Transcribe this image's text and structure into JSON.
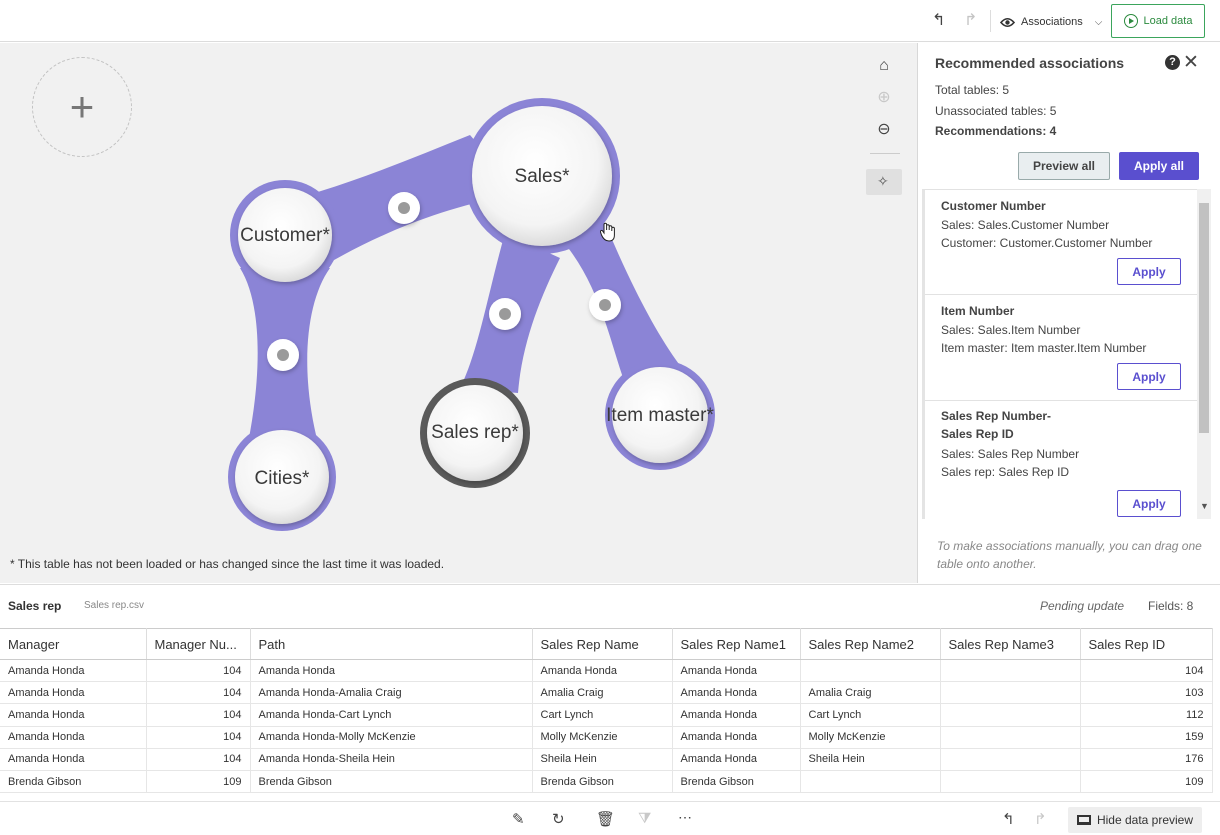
{
  "toolbar": {
    "undo_icon": "undo-icon",
    "redo_icon": "redo-icon",
    "associations_label": "Associations",
    "load_data_label": "Load data",
    "accent_color": "#2b8a3e"
  },
  "canvas": {
    "add_label": "+",
    "nodes": [
      {
        "label": "Customer*"
      },
      {
        "label": "Sales*"
      },
      {
        "label": "Cities*"
      },
      {
        "label": "Sales rep*"
      },
      {
        "label": "Item master*"
      }
    ],
    "footnote": "* This table has not been loaded or has changed since the last time it was loaded.",
    "link_color": "#8b84d6"
  },
  "panel": {
    "title": "Recommended associations",
    "total_tables": "Total tables: 5",
    "unassociated_tables": "Unassociated tables: 5",
    "recommendations": "Recommendations: 4",
    "preview_all": "Preview all",
    "apply_all": "Apply all",
    "apply_color": "#5a4fcf",
    "cards": [
      {
        "title": "Customer Number",
        "line1": "Sales: Sales.Customer Number",
        "line2": "Customer: Customer.Customer Number",
        "apply": "Apply"
      },
      {
        "title": "Item Number",
        "line1": "Sales: Sales.Item Number",
        "line2": "Item master: Item master.Item Number",
        "apply": "Apply"
      },
      {
        "title": "Sales Rep Number-Sales Rep ID",
        "line1": "Sales: Sales Rep Number",
        "line2": "Sales rep: Sales Rep ID",
        "apply": "Apply"
      }
    ],
    "hint": "To make associations manually, you can drag one table onto another."
  },
  "preview": {
    "table_name": "Sales rep",
    "file_name": "Sales rep.csv",
    "status": "Pending update",
    "fields": "Fields: 8",
    "columns": [
      "Manager",
      "Manager Nu...",
      "Path",
      "Sales Rep Name",
      "Sales Rep Name1",
      "Sales Rep Name2",
      "Sales Rep Name3",
      "Sales Rep ID"
    ],
    "rows": [
      [
        "Amanda Honda",
        "104",
        "Amanda Honda",
        "Amanda Honda",
        "Amanda Honda",
        "",
        "",
        "104"
      ],
      [
        "Amanda Honda",
        "104",
        "Amanda Honda-Amalia Craig",
        "Amalia Craig",
        "Amanda Honda",
        "Amalia Craig",
        "",
        "103"
      ],
      [
        "Amanda Honda",
        "104",
        "Amanda Honda-Cart Lynch",
        "Cart Lynch",
        "Amanda Honda",
        "Cart Lynch",
        "",
        "112"
      ],
      [
        "Amanda Honda",
        "104",
        "Amanda Honda-Molly McKenzie",
        "Molly McKenzie",
        "Amanda Honda",
        "Molly McKenzie",
        "",
        "159"
      ],
      [
        "Amanda Honda",
        "104",
        "Amanda Honda-Sheila Hein",
        "Sheila Hein",
        "Amanda Honda",
        "Sheila Hein",
        "",
        "176"
      ],
      [
        "Brenda Gibson",
        "109",
        "Brenda Gibson",
        "Brenda Gibson",
        "Brenda Gibson",
        "",
        "",
        "109"
      ]
    ]
  },
  "bottom": {
    "hide_preview": "Hide data preview"
  }
}
